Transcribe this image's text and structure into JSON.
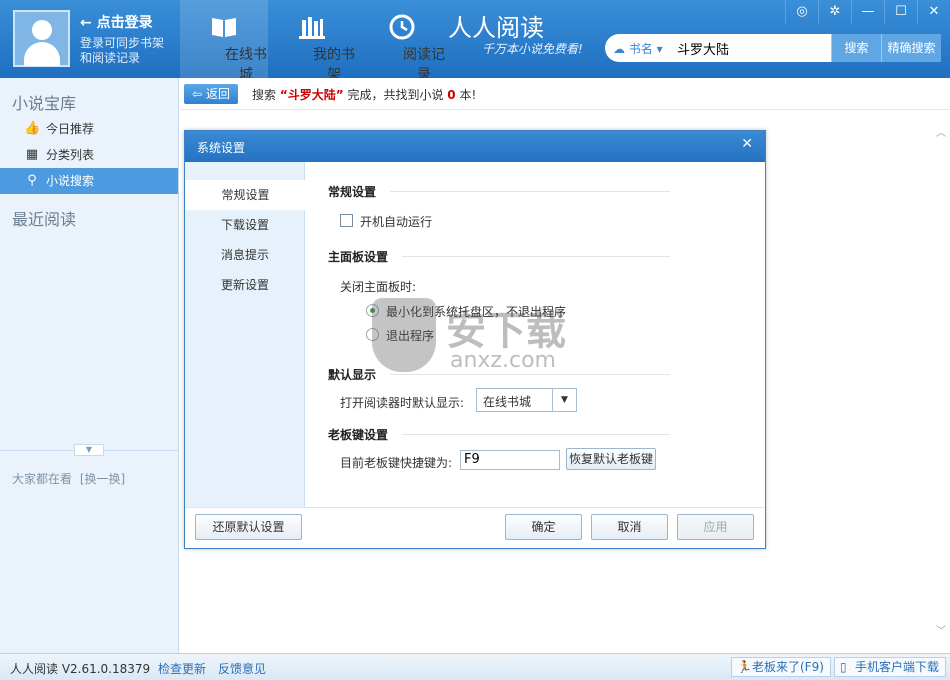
{
  "header": {
    "login_title": "点击登录",
    "login_subtitle": "登录可同步书架和阅读记录",
    "tabs": [
      {
        "label": "在线书城",
        "icon": "book-icon"
      },
      {
        "label": "我的书架",
        "icon": "bookshelf-icon"
      },
      {
        "label": "阅读记录",
        "icon": "clock-icon"
      }
    ],
    "brand_title": "人人阅读",
    "brand_slogan": "千万本小说免费看!",
    "window_buttons": [
      "skin-icon",
      "gear-icon",
      "minimize-icon",
      "maximize-icon",
      "close-icon"
    ],
    "search": {
      "type_label": "书名",
      "query": "斗罗大陆",
      "search_button": "搜索",
      "exact_button": "精确搜索"
    }
  },
  "sidebar": {
    "library_title": "小说宝库",
    "items": [
      {
        "label": "今日推荐",
        "icon": "thumbs-up-icon"
      },
      {
        "label": "分类列表",
        "icon": "grid-icon"
      },
      {
        "label": "小说搜索",
        "icon": "search-icon"
      }
    ],
    "recent_title": "最近阅读",
    "watching_text": "大家都在看",
    "refresh_link": "[换一换]"
  },
  "main": {
    "back_button": "返回",
    "result_prefix": "搜索",
    "result_keyword": "“斗罗大陆”",
    "result_middle": "完成，共找到小说",
    "result_count": "0",
    "result_suffix": "本!"
  },
  "dialog": {
    "title": "系统设置",
    "nav": [
      "常规设置",
      "下载设置",
      "消息提示",
      "更新设置"
    ],
    "general": {
      "title": "常规设置",
      "autostart_label": "开机自动运行",
      "autostart_checked": false
    },
    "panel": {
      "title": "主面板设置",
      "close_label": "关闭主面板时:",
      "option_minimize": "最小化到系统托盘区，不退出程序",
      "option_exit": "退出程序",
      "selected": "minimize"
    },
    "display": {
      "title": "默认显示",
      "label": "打开阅读器时默认显示:",
      "value": "在线书城"
    },
    "boss_key": {
      "title": "老板键设置",
      "label": "目前老板键快捷键为:",
      "value": "F9",
      "reset_button": "恢复默认老板键"
    },
    "restore_defaults_button": "还原默认设置",
    "ok_button": "确定",
    "cancel_button": "取消",
    "apply_button": "应用"
  },
  "watermark": {
    "text_large": "安下载",
    "text_small": "anxz.com"
  },
  "statusbar": {
    "version": "人人阅读 V2.61.0.18379",
    "check_update": "检查更新",
    "feedback": "反馈意见",
    "boss_key_btn": "老板来了(F9)",
    "mobile_btn": "手机客户端下载"
  }
}
